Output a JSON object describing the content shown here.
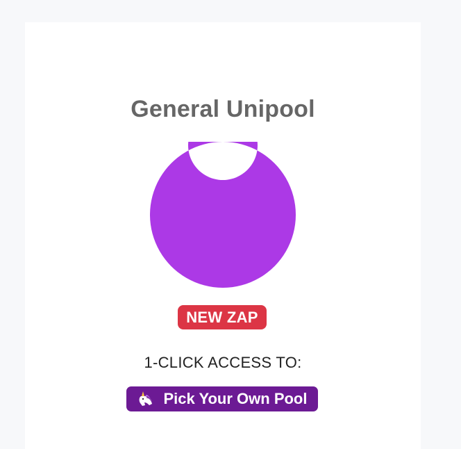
{
  "colors": {
    "page_background": "#f7f8fa",
    "card_background": "#ffffff",
    "title": "#666666",
    "donut_fill": "#ac39e6",
    "donut_separator": "#ffffff",
    "badge_bg": "#dc3545",
    "button_bg": "#6c1a94"
  },
  "card": {
    "title": "General Unipool",
    "badge_label": "NEW ZAP",
    "access_label": "1-CLICK ACCESS TO:",
    "button_label": "Pick Your Own Pool",
    "button_icon": "unicorn-icon"
  },
  "chart_data": {
    "type": "pie",
    "style": "donut",
    "categories": [
      ""
    ],
    "values": [
      100
    ],
    "title": "",
    "legend": false
  }
}
